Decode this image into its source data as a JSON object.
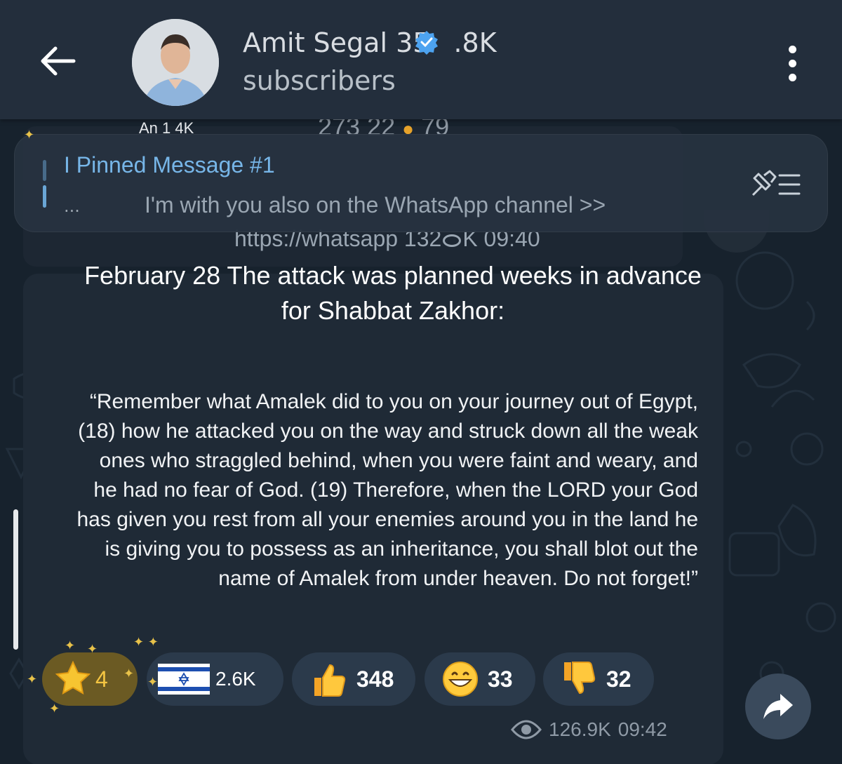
{
  "header": {
    "channel_title": "Amit Segal 35",
    "title_suffix": ".8K",
    "subtitle": "subscribers"
  },
  "previous_message": {
    "author": "An 1 4K",
    "stats": "273 22",
    "stats_tail": "79"
  },
  "pinned": {
    "title": "I Pinned Message #1",
    "ellipsis": "...",
    "preview": "I'm with you also on the WhatsApp channel >>",
    "link_line": "https://whatsapp 132",
    "link_suffix": "K 09:40"
  },
  "message": {
    "title": "February 28 The attack was planned weeks in advance for Shabbat Zakhor:",
    "quote": "“Remember what Amalek did to you on your journey out of Egypt, (18) how he attacked you on the way and struck down all the weak ones who straggled behind, when you were faint and weary, and he had no fear of God. (19) Therefore, when the LORD your God has given you rest from all your enemies around you in the land he is giving you to possess as an inheritance, you shall blot out the name of Amalek from under heaven. Do not forget!”",
    "views": "126.9K",
    "time": "09:42"
  },
  "reactions": [
    {
      "icon": "star-icon",
      "count": "4"
    },
    {
      "icon": "israel-flag-icon",
      "count": "2.6K"
    },
    {
      "icon": "thumbs-up-icon",
      "count": "348"
    },
    {
      "icon": "grinning-face-icon",
      "count": "33"
    },
    {
      "icon": "thumbs-down-icon",
      "count": "32"
    }
  ],
  "colors": {
    "header_bg": "#232e3c",
    "bubble_bg": "#1f2a36",
    "accent_blue": "#77b6e8",
    "verified_blue": "#4da3f0",
    "star_chip": "#6b5a23"
  }
}
